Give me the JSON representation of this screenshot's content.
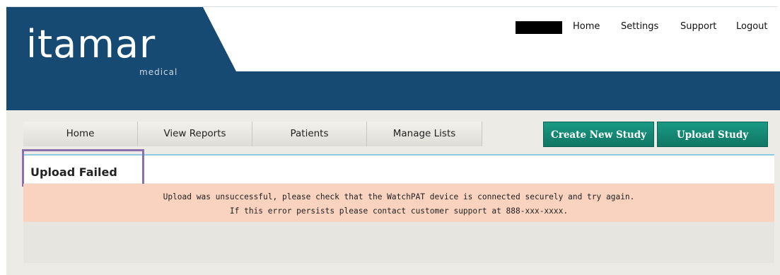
{
  "header": {
    "logo_main": "itamar",
    "logo_sub": "medical",
    "top_links": [
      "Home",
      "Settings",
      "Support",
      "Logout"
    ]
  },
  "nav": {
    "tabs": [
      "Home",
      "View Reports",
      "Patients",
      "Manage Lists"
    ]
  },
  "actions": {
    "create_label": "Create New Study",
    "upload_label": "Upload Study"
  },
  "panel": {
    "title": "Upload Failed",
    "error_line1": "Upload was unsuccessful, please check that the WatchPAT device is connected securely and try again.",
    "error_line2": "If this error persists please contact customer support at 888-xxx-xxxx."
  },
  "colors": {
    "header_blue": "#174a73",
    "button_teal": "#128a74",
    "error_bg": "#f9d3bf",
    "highlight": "#8a71ad"
  }
}
